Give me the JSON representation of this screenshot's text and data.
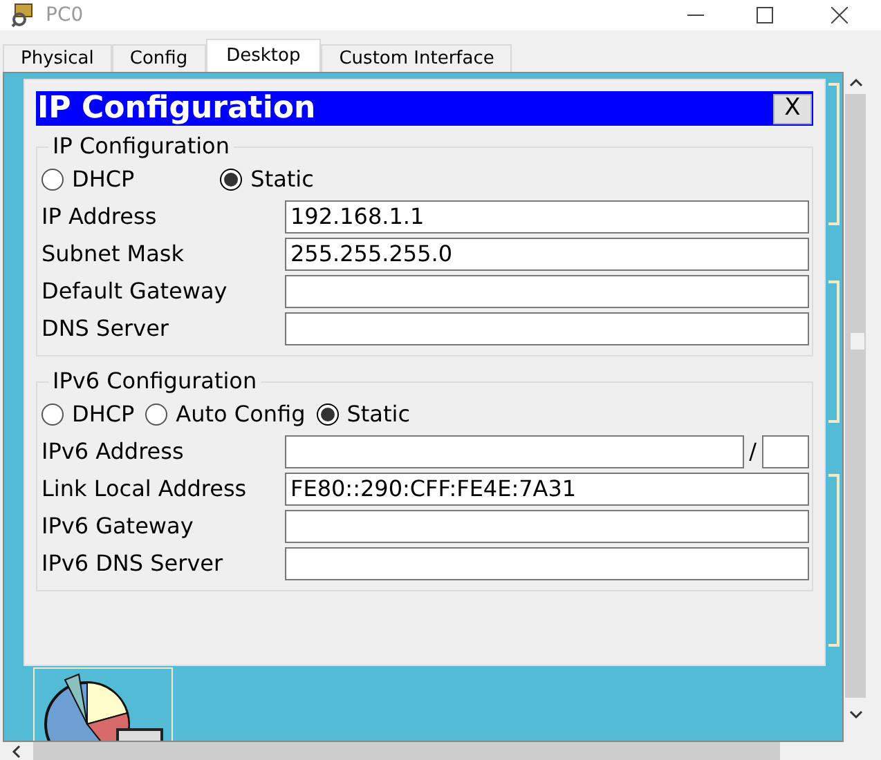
{
  "window": {
    "title": "PC0"
  },
  "tabs": [
    {
      "label": "Physical",
      "selected": false
    },
    {
      "label": "Config",
      "selected": false
    },
    {
      "label": "Desktop",
      "selected": true
    },
    {
      "label": "Custom Interface",
      "selected": false
    }
  ],
  "dialog": {
    "title": "IP Configuration",
    "close": "X",
    "ipv4": {
      "legend": "IP Configuration",
      "modes": [
        {
          "label": "DHCP",
          "selected": false
        },
        {
          "label": "Static",
          "selected": true
        }
      ],
      "fields": [
        {
          "label": "IP Address",
          "value": "192.168.1.1"
        },
        {
          "label": "Subnet Mask",
          "value": "255.255.255.0"
        },
        {
          "label": "Default Gateway"
        },
        {
          "label": "DNS Server"
        }
      ]
    },
    "ipv6": {
      "legend": "IPv6 Configuration",
      "modes": [
        {
          "label": "DHCP",
          "selected": false
        },
        {
          "label": "Auto Config",
          "selected": false
        },
        {
          "label": "Static",
          "selected": true
        }
      ],
      "fields": [
        {
          "label": "IPv6 Address",
          "prefix_separator": "/"
        },
        {
          "label": "Link Local Address",
          "value": "FE80::290:CFF:FE4E:7A31"
        },
        {
          "label": "IPv6 Gateway"
        },
        {
          "label": "IPv6 DNS Server"
        }
      ]
    }
  }
}
